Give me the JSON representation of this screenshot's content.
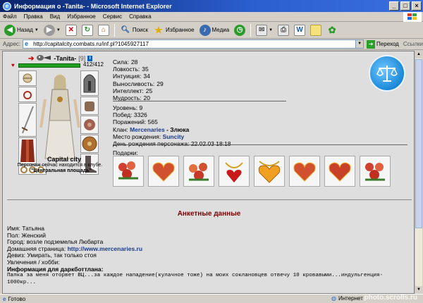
{
  "window": {
    "title": "Информация о -Tanita- - Microsoft Internet Explorer"
  },
  "menu": [
    "Файл",
    "Правка",
    "Вид",
    "Избранное",
    "Сервис",
    "Справка"
  ],
  "toolbar": {
    "back": "Назад",
    "search": "Поиск",
    "favorites": "Избранное",
    "media": "Медиа"
  },
  "address": {
    "label": "Адрес:",
    "url": "http://capitalcity.combats.ru/inf.pl?1045927117",
    "go": "Переход",
    "links": "Ссылки"
  },
  "character": {
    "name": "-Tanita-",
    "level": "[9]",
    "hp": "412/412",
    "hp_fraction": 1.0,
    "city_name": "Capital city",
    "location_note": "Персонаж сейчас находится в клубе.",
    "location": "\"Центральная площадь\""
  },
  "stats": [
    {
      "label": "Сила:",
      "value": "28"
    },
    {
      "label": "Ловкость:",
      "value": "35"
    },
    {
      "label": "Интуиция:",
      "value": "34"
    },
    {
      "label": "Выносливость:",
      "value": "29"
    },
    {
      "label": "Интеллект:",
      "value": "25"
    },
    {
      "label": "Мудрость:",
      "value": "20"
    }
  ],
  "info": {
    "level_label": "Уровень:",
    "level_value": "9",
    "wins_label": "Побед:",
    "wins_value": "3326",
    "losses_label": "Поражений:",
    "losses_value": "565",
    "clan_label": "Клан:",
    "clan_name": "Mercenaries",
    "clan_rank": "- Злюка",
    "birthplace_label": "Место рождения:",
    "birthplace_value": "Suncity",
    "birthday_label": "День рождения персонажа:",
    "birthday_value": "22.02.03 18:18"
  },
  "gifts_label": "Подарки:",
  "anket": {
    "title": "Анкетные данные",
    "name": "Имя: Татьяна",
    "sex": "Пол: Женский",
    "city": "Город: возле подземелья  Любарта",
    "homepage_label": "Домашняя страница: ",
    "homepage_url": "http://www.mercenaries.ru",
    "motto": "Девиз: Умирать, так только стоя",
    "hobby": "Увлечения / хобби:",
    "dark_info": "Информация для даркботтлана:",
    "text1": "Папка за меня оторвет ВЦ...за каждое нападение(кулачное тоже) на моих соклановцев отвечу 10 кровавыми...индульгенция-",
    "text2": "1000кр..."
  },
  "status": {
    "text": "Готово",
    "zone": "Интернет"
  },
  "watermark": "photo.scrolls.ru",
  "colors": {
    "titlebar": "#0a246a",
    "hpbar": "#1ea01e",
    "anket_title": "#7a0000",
    "link": "#1a3a8a"
  }
}
